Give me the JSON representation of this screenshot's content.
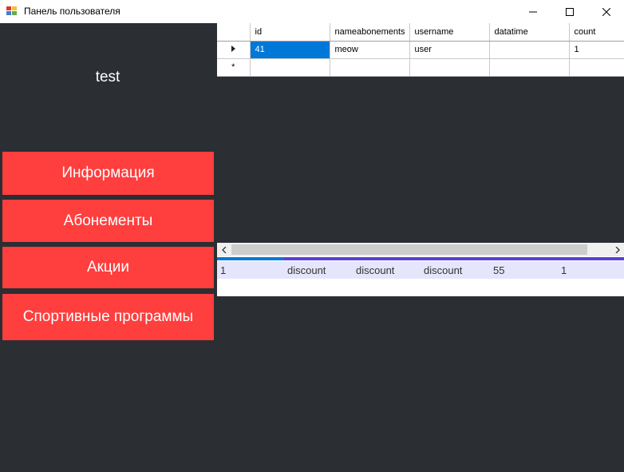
{
  "window": {
    "title": "Панель пользователя",
    "controls": {
      "minimize": "—",
      "maximize": "☐",
      "close": "✕"
    }
  },
  "sidebar": {
    "user_name": "test",
    "items": [
      {
        "label": "Информация"
      },
      {
        "label": "Абонементы"
      },
      {
        "label": "Акции"
      },
      {
        "label": "Спортивные программы"
      }
    ]
  },
  "grid": {
    "columns": [
      "id",
      "nameabonements",
      "username",
      "datatime",
      "count"
    ],
    "rows": [
      {
        "id": "41",
        "nameabonements": "meow",
        "username": "user",
        "datatime": "",
        "count": "1"
      }
    ],
    "new_row_marker": "*"
  },
  "listview": {
    "rows": [
      [
        "1",
        "discount",
        "discount",
        "discount",
        "55",
        "1"
      ]
    ]
  },
  "colors": {
    "background": "#2b2e33",
    "accent_button": "#ff3e3e",
    "selection": "#0078d7"
  }
}
